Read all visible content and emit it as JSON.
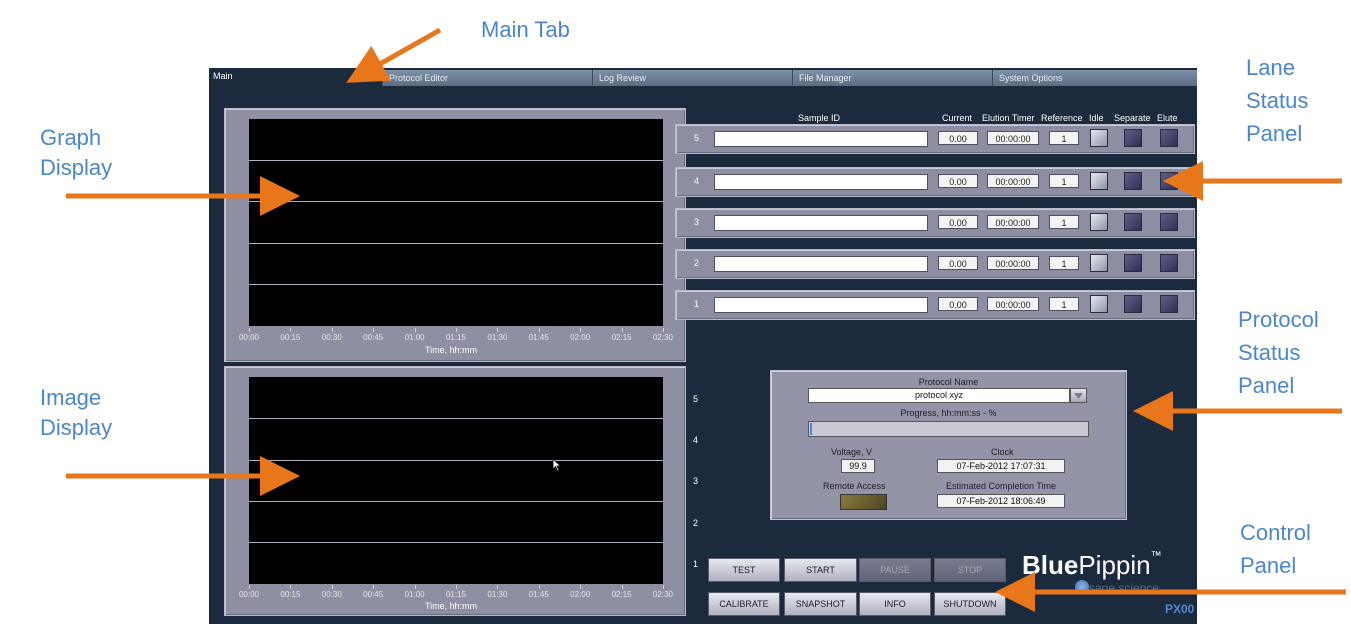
{
  "callouts": {
    "main_tab": "Main Tab",
    "graph_display_1": "Graph",
    "graph_display_2": "Display",
    "image_display_1": "Image",
    "image_display_2": "Display",
    "lane_status_1": "Lane",
    "lane_status_2": "Status",
    "lane_status_3": "Panel",
    "protocol_status_1": "Protocol",
    "protocol_status_2": "Status",
    "protocol_status_3": "Panel",
    "control_panel_1": "Control",
    "control_panel_2": "Panel"
  },
  "tabs": [
    "Main",
    "Protocol Editor",
    "Log Review",
    "File Manager",
    "System Options"
  ],
  "graph": {
    "ticks": [
      "00:00",
      "00:15",
      "00:30",
      "00:45",
      "01:00",
      "01:15",
      "01:30",
      "01:45",
      "02:00",
      "02:15",
      "02:30"
    ],
    "xlabel": "Time, hh:mm"
  },
  "image": {
    "ticks": [
      "00:00",
      "00:15",
      "00:30",
      "00:45",
      "01:00",
      "01:15",
      "01:30",
      "01:45",
      "02:00",
      "02:15",
      "02:30"
    ],
    "xlabel": "Time, hh:mm"
  },
  "lane_headers": {
    "sample_id": "Sample ID",
    "current": "Current",
    "elution_timer": "Elution Timer",
    "reference": "Reference",
    "idle": "Idle",
    "separate": "Separate",
    "elute": "Elute"
  },
  "lanes": [
    {
      "num": "5",
      "sample_id": "",
      "current": "0.00",
      "timer": "00:00:00",
      "reference": "1"
    },
    {
      "num": "4",
      "sample_id": "",
      "current": "0.00",
      "timer": "00:00:00",
      "reference": "1"
    },
    {
      "num": "3",
      "sample_id": "",
      "current": "0.00",
      "timer": "00:00:00",
      "reference": "1"
    },
    {
      "num": "2",
      "sample_id": "",
      "current": "0.00",
      "timer": "00:00:00",
      "reference": "1"
    },
    {
      "num": "1",
      "sample_id": "",
      "current": "0.00",
      "timer": "00:00:00",
      "reference": "1"
    }
  ],
  "image_lane_numbers": [
    "5",
    "4",
    "3",
    "2",
    "1"
  ],
  "protocol": {
    "name_label": "Protocol Name",
    "name_value": "protocol xyz",
    "progress_label": "Progress, hh:mm:ss - %",
    "progress_fraction": 0.0,
    "voltage_label": "Voltage, V",
    "voltage_value": "99.9",
    "clock_label": "Clock",
    "clock_value": "07-Feb-2012   17:07:31",
    "remote_label": "Remote Access",
    "ect_label": "Estimated Completion Time",
    "ect_value": "07-Feb-2012   18:06:49"
  },
  "buttons": {
    "test": "TEST",
    "start": "START",
    "pause": "PAUSE",
    "stop": "STOP",
    "calibrate": "CALIBRATE",
    "snapshot": "SNAPSHOT",
    "info": "INFO",
    "shutdown": "SHUTDOWN"
  },
  "brand": {
    "blue": "Blue",
    "pippin": "Pippin",
    "tm": "™",
    "company": "sage science",
    "model": "PX00"
  },
  "colors": {
    "callout_text": "#4a86c8",
    "arrow": "#e8761a",
    "app_bg": "#1b2b3d",
    "panel": "#8f8fa3"
  }
}
